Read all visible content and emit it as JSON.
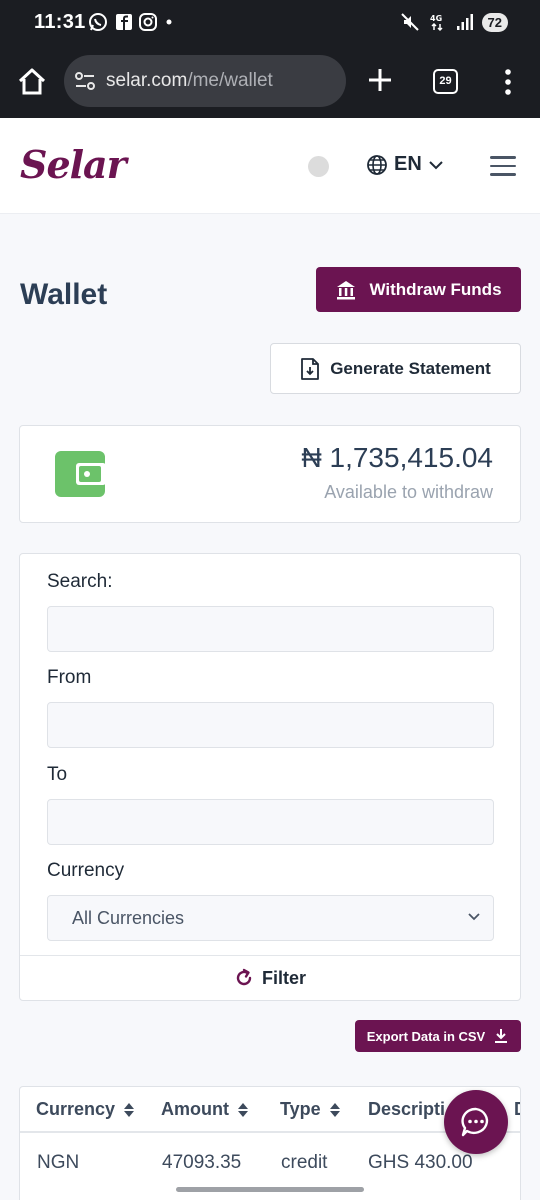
{
  "status_bar": {
    "time": "11:31",
    "battery": "72",
    "network": "4G"
  },
  "browser": {
    "url_host": "selar.com",
    "url_path": "/me/wallet",
    "tab_count": "29"
  },
  "header": {
    "logo": "Selar",
    "language": "EN"
  },
  "wallet": {
    "title": "Wallet",
    "withdraw_label": "Withdraw Funds",
    "statement_label": "Generate Statement",
    "balance": "₦ 1,735,415.04",
    "balance_caption": "Available to withdraw"
  },
  "filter": {
    "search_label": "Search:",
    "search_value": "",
    "from_label": "From",
    "from_value": "",
    "to_label": "To",
    "to_value": "",
    "currency_label": "Currency",
    "currency_selected": "All Currencies",
    "filter_label": "Filter"
  },
  "export_label": "Export Data in CSV",
  "table": {
    "columns": [
      "Currency",
      "Amount",
      "Type",
      "Descripti",
      "D"
    ],
    "rows": [
      [
        "NGN",
        "47093.35",
        "credit",
        "GHS 430.00"
      ]
    ]
  },
  "colors": {
    "brand": "#6b1451",
    "wallet_icon": "#6cc26a"
  }
}
